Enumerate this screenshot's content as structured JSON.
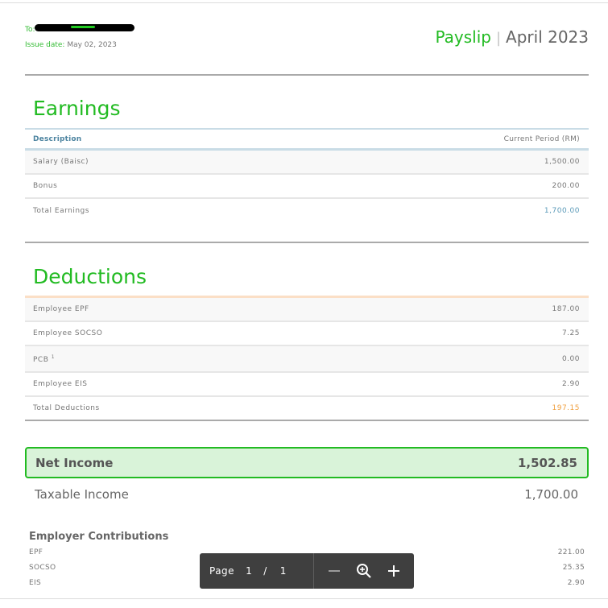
{
  "header": {
    "to_label": "To:",
    "issue_date_label": "Issue date:",
    "issue_date": "May 02, 2023",
    "doc_type": "Payslip",
    "separator": "|",
    "period": "April 2023"
  },
  "earnings": {
    "title": "Earnings",
    "columns": {
      "description": "Description",
      "amount": "Current Period (RM)"
    },
    "rows": [
      {
        "label": "Salary (Baisc)",
        "amount": "1,500.00"
      },
      {
        "label": "Bonus",
        "amount": "200.00"
      }
    ],
    "total": {
      "label": "Total Earnings",
      "amount": "1,700.00"
    }
  },
  "deductions": {
    "title": "Deductions",
    "rows": [
      {
        "label": "Employee EPF",
        "amount": "187.00"
      },
      {
        "label": "Employee SOCSO",
        "amount": "7.25"
      },
      {
        "label": "PCB",
        "footnote": "1",
        "amount": "0.00"
      },
      {
        "label": "Employee EIS",
        "amount": "2.90"
      }
    ],
    "total": {
      "label": "Total Deductions",
      "amount": "197.15"
    }
  },
  "net_income": {
    "label": "Net Income",
    "amount": "1,502.85"
  },
  "taxable_income": {
    "label": "Taxable Income",
    "amount": "1,700.00"
  },
  "employer_contributions": {
    "title": "Employer Contributions",
    "rows": [
      {
        "label": "EPF",
        "amount": "221.00"
      },
      {
        "label": "SOCSO",
        "amount": "25.35"
      },
      {
        "label": "EIS",
        "amount": "2.90"
      }
    ]
  },
  "pdf_toolbar": {
    "page_label": "Page",
    "current_page": "1",
    "page_sep": "/",
    "total_pages": "1",
    "icons": {
      "zoom_out": "minus-icon",
      "zoom_fit": "zoom-icon",
      "zoom_in": "plus-icon"
    }
  },
  "colors": {
    "brand_green": "#22bb22",
    "net_income_bg": "#d9f3d9",
    "earnings_total": "#5a9ab8",
    "deductions_total": "#f0a040"
  }
}
